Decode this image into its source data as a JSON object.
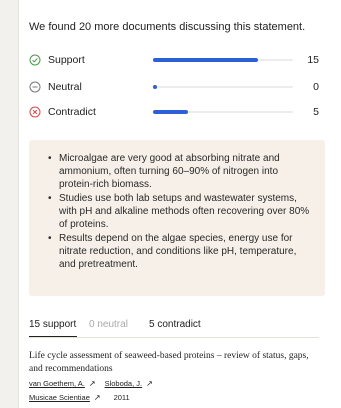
{
  "lead": "We found 20 more documents discussing this statement.",
  "stances": [
    {
      "label": "Support",
      "count": "15",
      "fraction": 0.75,
      "color": "#4a9a4a"
    },
    {
      "label": "Neutral",
      "count": "0",
      "fraction": 0.0,
      "color": "#777777"
    },
    {
      "label": "Contradict",
      "count": "5",
      "fraction": 0.25,
      "color": "#d24a4a"
    }
  ],
  "summary": [
    "Microalgae are very good at absorbing nitrate and ammonium, often turning 60–90% of nitrogen into protein-rich biomass.",
    "Studies use both lab setups and wastewater systems, with pH and alkaline methods often recovering over 80% of proteins.",
    "Results depend on the algae species, energy use for nitrate reduction, and conditions like pH, temperature, and pretreatment."
  ],
  "tabs": [
    {
      "label": "15 support",
      "active": true
    },
    {
      "label": "0 neutral",
      "active": false
    },
    {
      "label": "5 contradict",
      "active": false
    }
  ],
  "document": {
    "title": "Life cycle assessment of seaweed-based proteins – review of status, gaps, and recommendations",
    "authors": [
      "van Goethem, A.",
      "Sloboda, J."
    ],
    "journal": "Musicae Scientiae",
    "year": "2011"
  }
}
